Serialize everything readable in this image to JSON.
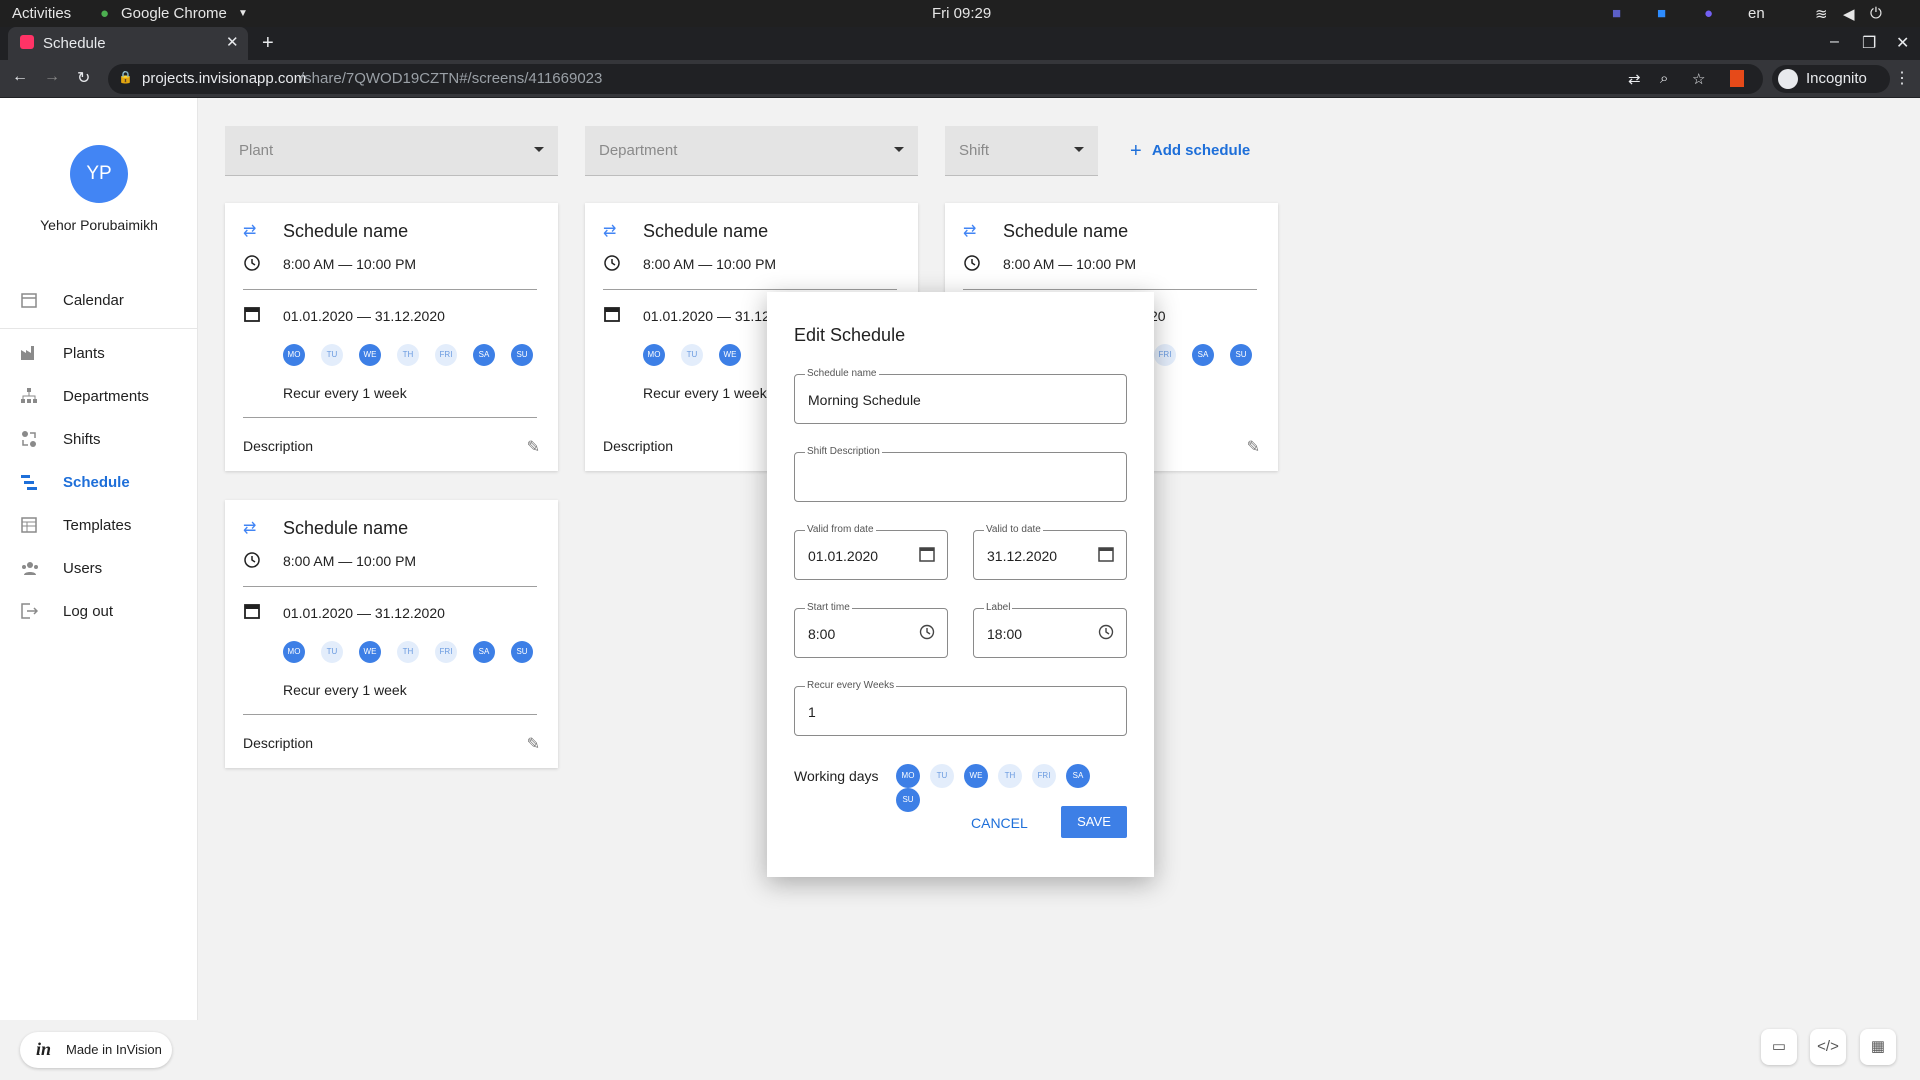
{
  "os": {
    "activities": "Activities",
    "app": "Google Chrome",
    "clock": "Fri 09:29",
    "lang": "en"
  },
  "browser": {
    "tab_title": "Schedule",
    "url_domain": "projects.invisionapp.com",
    "url_path": "/share/7QWOD19CZTN#/screens/411669023",
    "profile": "Incognito"
  },
  "user": {
    "initials": "YP",
    "name": "Yehor Porubaimikh"
  },
  "nav": [
    {
      "label": "Calendar",
      "icon": "calendar-icon"
    },
    {
      "label": "Plants",
      "icon": "factory-icon"
    },
    {
      "label": "Departments",
      "icon": "org-chart-icon"
    },
    {
      "label": "Shifts",
      "icon": "shifts-icon"
    },
    {
      "label": "Schedule",
      "icon": "schedule-icon",
      "active": true
    },
    {
      "label": "Templates",
      "icon": "templates-icon"
    },
    {
      "label": "Users",
      "icon": "users-icon"
    },
    {
      "label": "Log out",
      "icon": "logout-icon"
    }
  ],
  "filters": {
    "plant": "Plant",
    "department": "Department",
    "shift": "Shift",
    "add": "Add schedule"
  },
  "card": {
    "name": "Schedule name",
    "time": "8:00 AM — 10:00 PM",
    "dates": "01.01.2020 — 31.12.2020",
    "recur": "Recur every 1 week",
    "description": "Description",
    "days": [
      "MO",
      "TU",
      "WE",
      "TH",
      "FRI",
      "SA",
      "SU"
    ]
  },
  "cards_partial": {
    "dates2": "01.01.2020 — 31.12",
    "recur2": "Recur every 1 week",
    "dates3_tail": "20"
  },
  "dialog": {
    "title": "Edit Schedule",
    "name_label": "Schedule name",
    "name_value": "Morning Schedule",
    "desc_label": "Shift Description",
    "desc_value": "",
    "from_label": "Valid from date",
    "from_value": "01.01.2020",
    "to_label": "Valid to date",
    "to_value": "31.12.2020",
    "start_label": "Start time",
    "start_value": "8:00",
    "end_label": "Label",
    "end_value": "18:00",
    "recur_label": "Recur every Weeks",
    "recur_value": "1",
    "days_label": "Working days",
    "cancel": "CANCEL",
    "save": "SAVE"
  },
  "footer": {
    "badge": "Made in InVision"
  },
  "colors": {
    "accent": "#4285f4",
    "day_on": "#3d7fe6",
    "day_off": "#e3edfb"
  }
}
